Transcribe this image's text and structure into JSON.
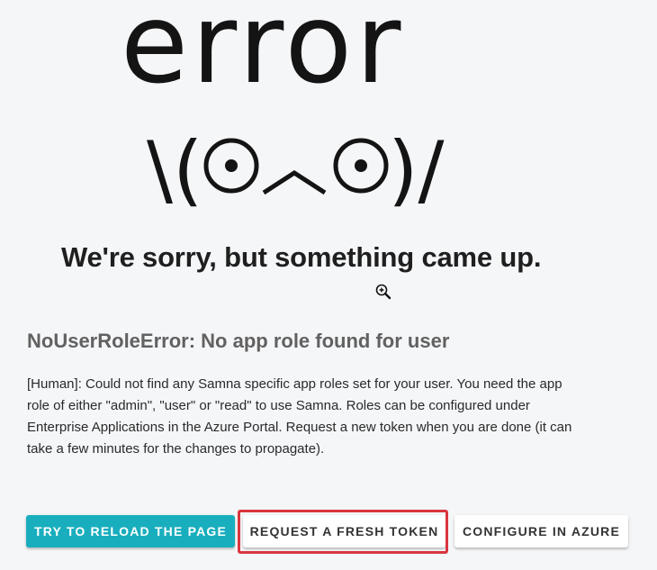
{
  "hero": {
    "big_word": "error",
    "face_left_paren": "\\(",
    "face_right_paren": ")/"
  },
  "headline": "We're sorry, but something came up.",
  "error": {
    "title": "NoUserRoleError: No app role found for user",
    "message": "[Human]: Could not find any Samna specific app roles set for your user. You need the app role of either \"admin\", \"user\" or \"read\" to use Samna. Roles can be configured under Enterprise Applications in the Azure Portal. Request a new token when you are done (it can take a few minutes for the changes to propagate)."
  },
  "actions": {
    "reload_label": "TRY TO RELOAD THE PAGE",
    "token_label": "REQUEST A FRESH TOKEN",
    "azure_label": "CONFIGURE IN AZURE"
  },
  "colors": {
    "accent": "#19aebd",
    "highlight": "#d9363e",
    "background": "#f5f6f8"
  },
  "icons": {
    "cursor": "zoom-in-cursor-icon"
  }
}
